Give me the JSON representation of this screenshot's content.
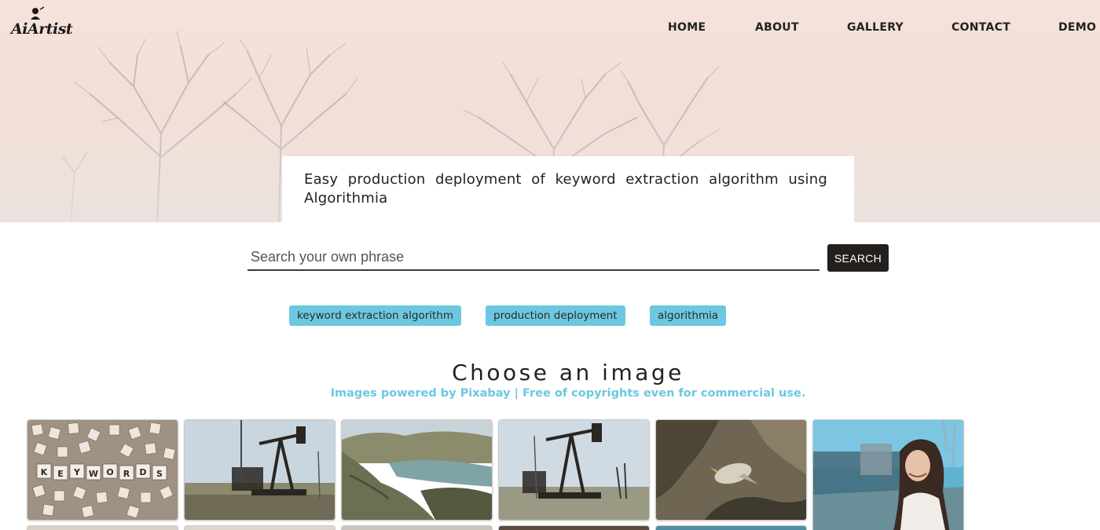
{
  "brand": {
    "name": "AiArtist"
  },
  "nav": {
    "items": [
      {
        "label": "HOME"
      },
      {
        "label": "ABOUT"
      },
      {
        "label": "GALLERY"
      },
      {
        "label": "CONTACT"
      },
      {
        "label": "DEMO"
      }
    ]
  },
  "hero": {
    "headline": "Easy production deployment of keyword extraction algorithm using Algorithmia"
  },
  "search": {
    "placeholder": "Search your own phrase",
    "value": "",
    "button_label": "SEARCH"
  },
  "tags": [
    {
      "label": "keyword extraction algorithm"
    },
    {
      "label": "production deployment"
    },
    {
      "label": "algorithmia"
    }
  ],
  "gallery": {
    "title": "Choose an image",
    "subtitle": "Images powered by Pixabay | Free of copyrights even for commercial use.",
    "accent_color": "#6cc8e0",
    "images": [
      {
        "subject": "scrabble-tiles-keywords",
        "tile_text": "KEYWORDS"
      },
      {
        "subject": "oil-pumpjack"
      },
      {
        "subject": "coastal-landscape"
      },
      {
        "subject": "oil-pumpjack"
      },
      {
        "subject": "bird-on-rock"
      },
      {
        "subject": "smiling-woman-outdoors"
      }
    ]
  },
  "colors": {
    "hero_bg": "#f3e2da",
    "button_bg": "#231f1c",
    "tag_bg": "#6cc8e0"
  }
}
